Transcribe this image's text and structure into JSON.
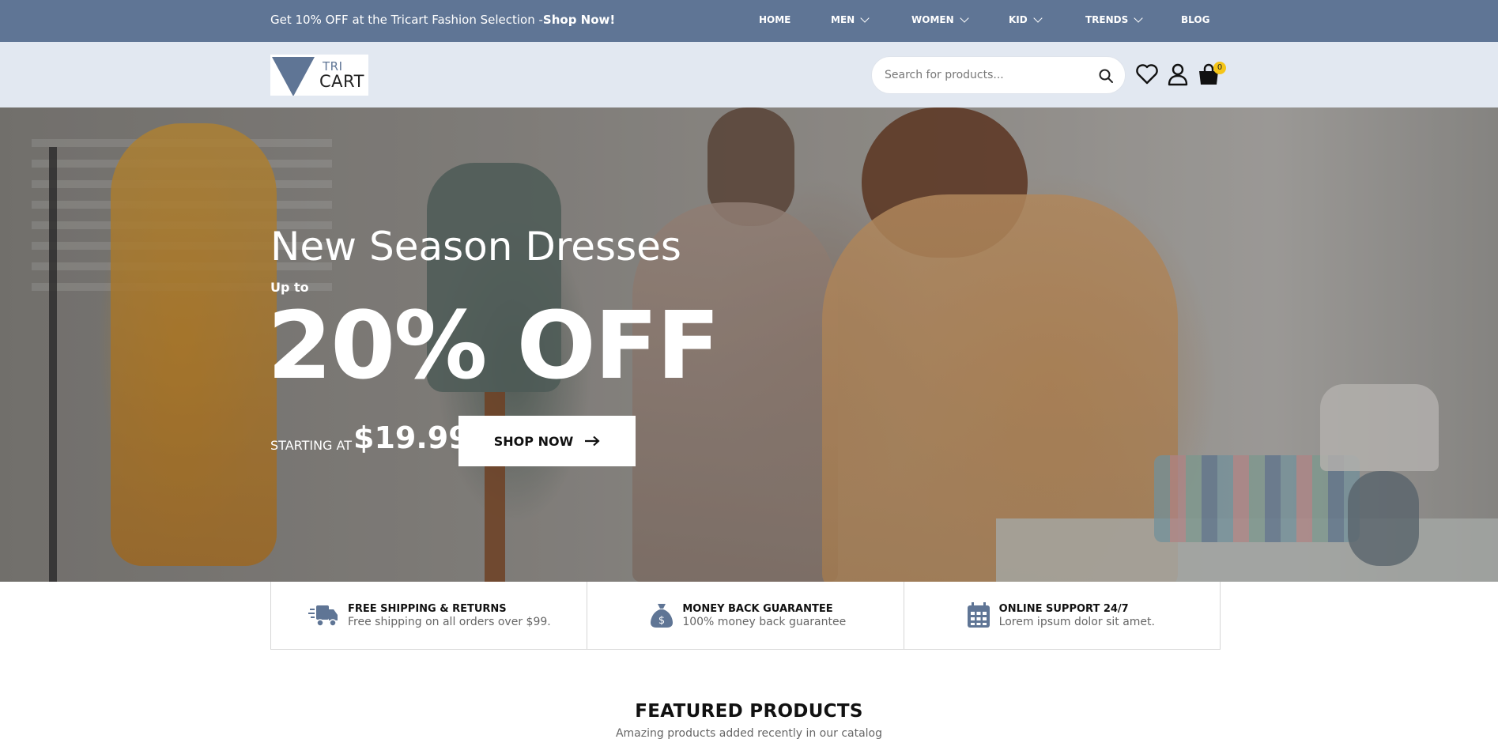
{
  "topbar": {
    "promo_text": "Get 10% OFF at the Tricart Fashion Selection -",
    "promo_link": "Shop Now!",
    "nav": [
      {
        "label": "HOME",
        "dropdown": false
      },
      {
        "label": "MEN",
        "dropdown": true
      },
      {
        "label": "WOMEN",
        "dropdown": true
      },
      {
        "label": "KID",
        "dropdown": true
      },
      {
        "label": "TRENDS",
        "dropdown": true
      },
      {
        "label": "BLOG",
        "dropdown": false
      }
    ]
  },
  "header": {
    "logo": {
      "line1": "TRI",
      "line2": "CART"
    },
    "search": {
      "placeholder": "Search for products..."
    },
    "icons": [
      "heart-icon",
      "user-icon",
      "shopping-bag-icon"
    ],
    "cart_count": "0"
  },
  "hero": {
    "title": "New Season Dresses",
    "upto": "Up to",
    "offer": "20% OFF",
    "starting_label": "STARTING AT",
    "price": "$19.99",
    "button_label": "SHOP NOW"
  },
  "features": [
    {
      "icon": "truck-icon",
      "title": "FREE SHIPPING & RETURNS",
      "desc": "Free shipping on all orders over $99."
    },
    {
      "icon": "money-bag-icon",
      "title": "MONEY BACK GUARANTEE",
      "desc": "100% money back guarantee"
    },
    {
      "icon": "calendar-icon",
      "title": "ONLINE SUPPORT 24/7",
      "desc": "Lorem ipsum dolor sit amet."
    }
  ],
  "featured": {
    "title": "FEATURED PRODUCTS",
    "subtitle": "Amazing products added recently in our catalog"
  },
  "colors": {
    "topbar": "#5f7595",
    "header": "#e2e8f1",
    "accent": "#f5c518"
  }
}
